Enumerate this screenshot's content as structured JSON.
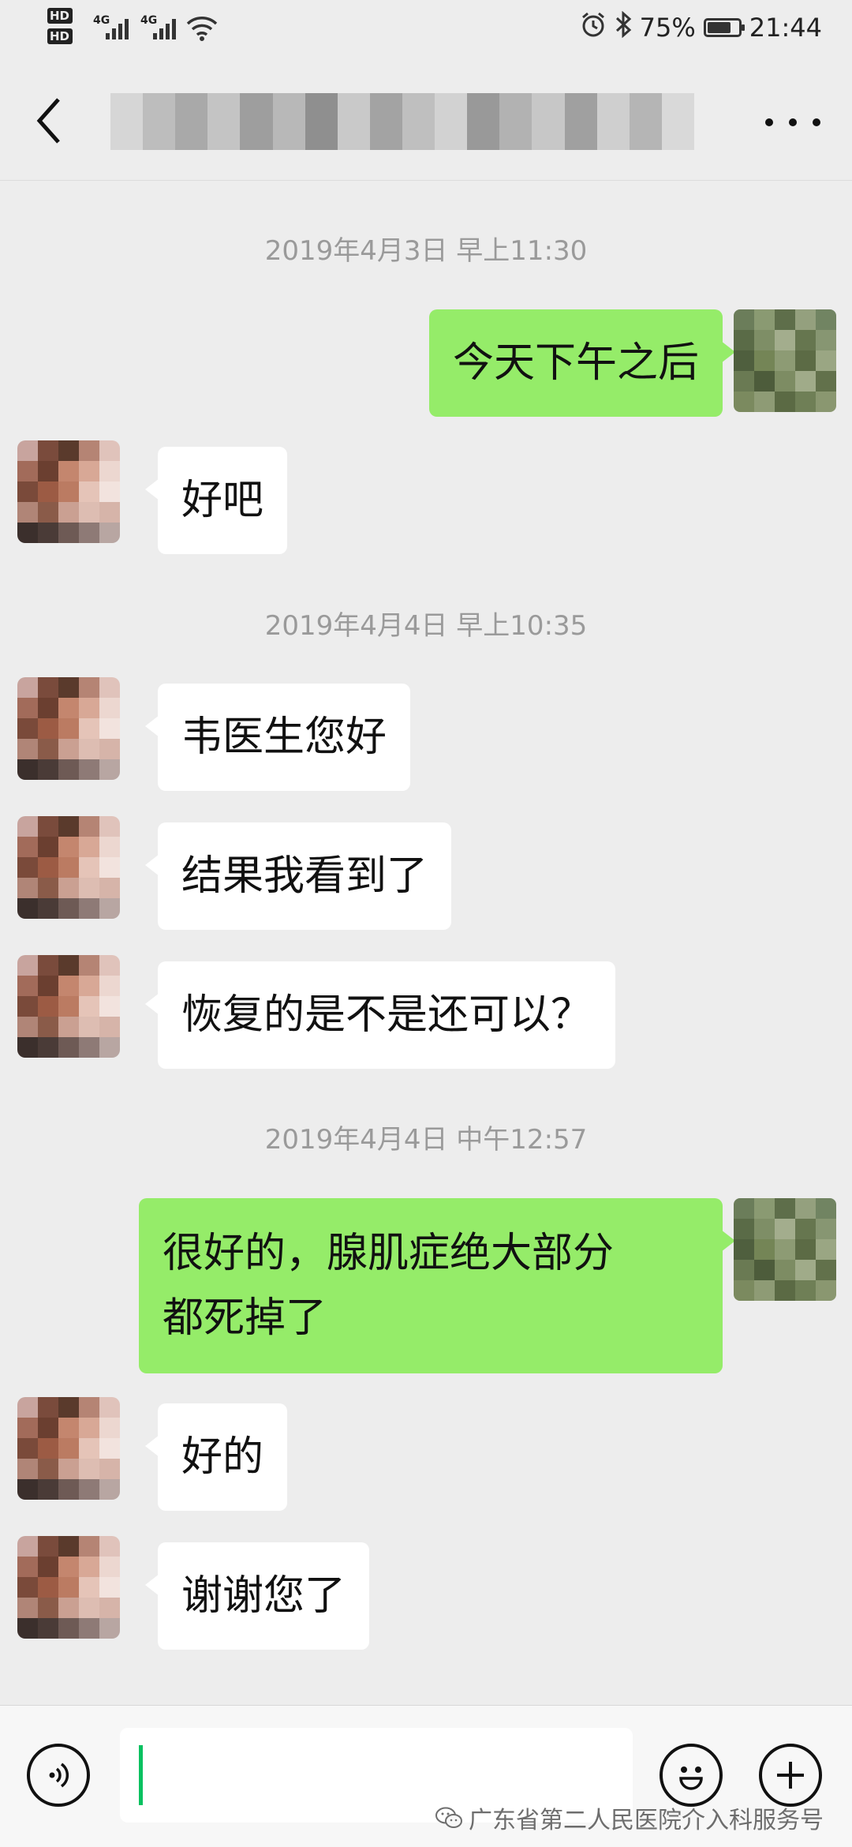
{
  "status_bar": {
    "battery": "75%",
    "time": "21:44",
    "sim1": "HD",
    "sim2": "HD",
    "net1": "4G",
    "net2": "4G"
  },
  "header": {
    "back_icon": "chevron-left-icon",
    "more_icon": "ellipsis-icon"
  },
  "messages": [
    {
      "type": "time",
      "text": "2019年4月3日 早上11:30"
    },
    {
      "type": "out",
      "text": "今天下午之后"
    },
    {
      "type": "in",
      "text": "好吧"
    },
    {
      "type": "time",
      "text": "2019年4月4日 早上10:35"
    },
    {
      "type": "in",
      "text": "韦医生您好"
    },
    {
      "type": "in",
      "text": "结果我看到了"
    },
    {
      "type": "in",
      "text": "恢复的是不是还可以？"
    },
    {
      "type": "time",
      "text": "2019年4月4日 中午12:57"
    },
    {
      "type": "out",
      "text": "很好的，腺肌症绝大部分都死掉了"
    },
    {
      "type": "in",
      "text": "好的"
    },
    {
      "type": "in",
      "text": "谢谢您了"
    }
  ],
  "out_multiline": [
    "很好的，腺肌症绝大部分",
    "都死掉了"
  ],
  "input_bar": {
    "voice_icon": "voice-icon",
    "emoji_icon": "emoji-icon",
    "plus_icon": "plus-icon",
    "input_value": ""
  },
  "watermark": "广东省第二人民医院介入科服务号",
  "colors": {
    "background": "#ededed",
    "out_bubble": "#95ec69",
    "in_bubble": "#ffffff",
    "timestamp": "#9a9a9a",
    "caret": "#07c160"
  }
}
